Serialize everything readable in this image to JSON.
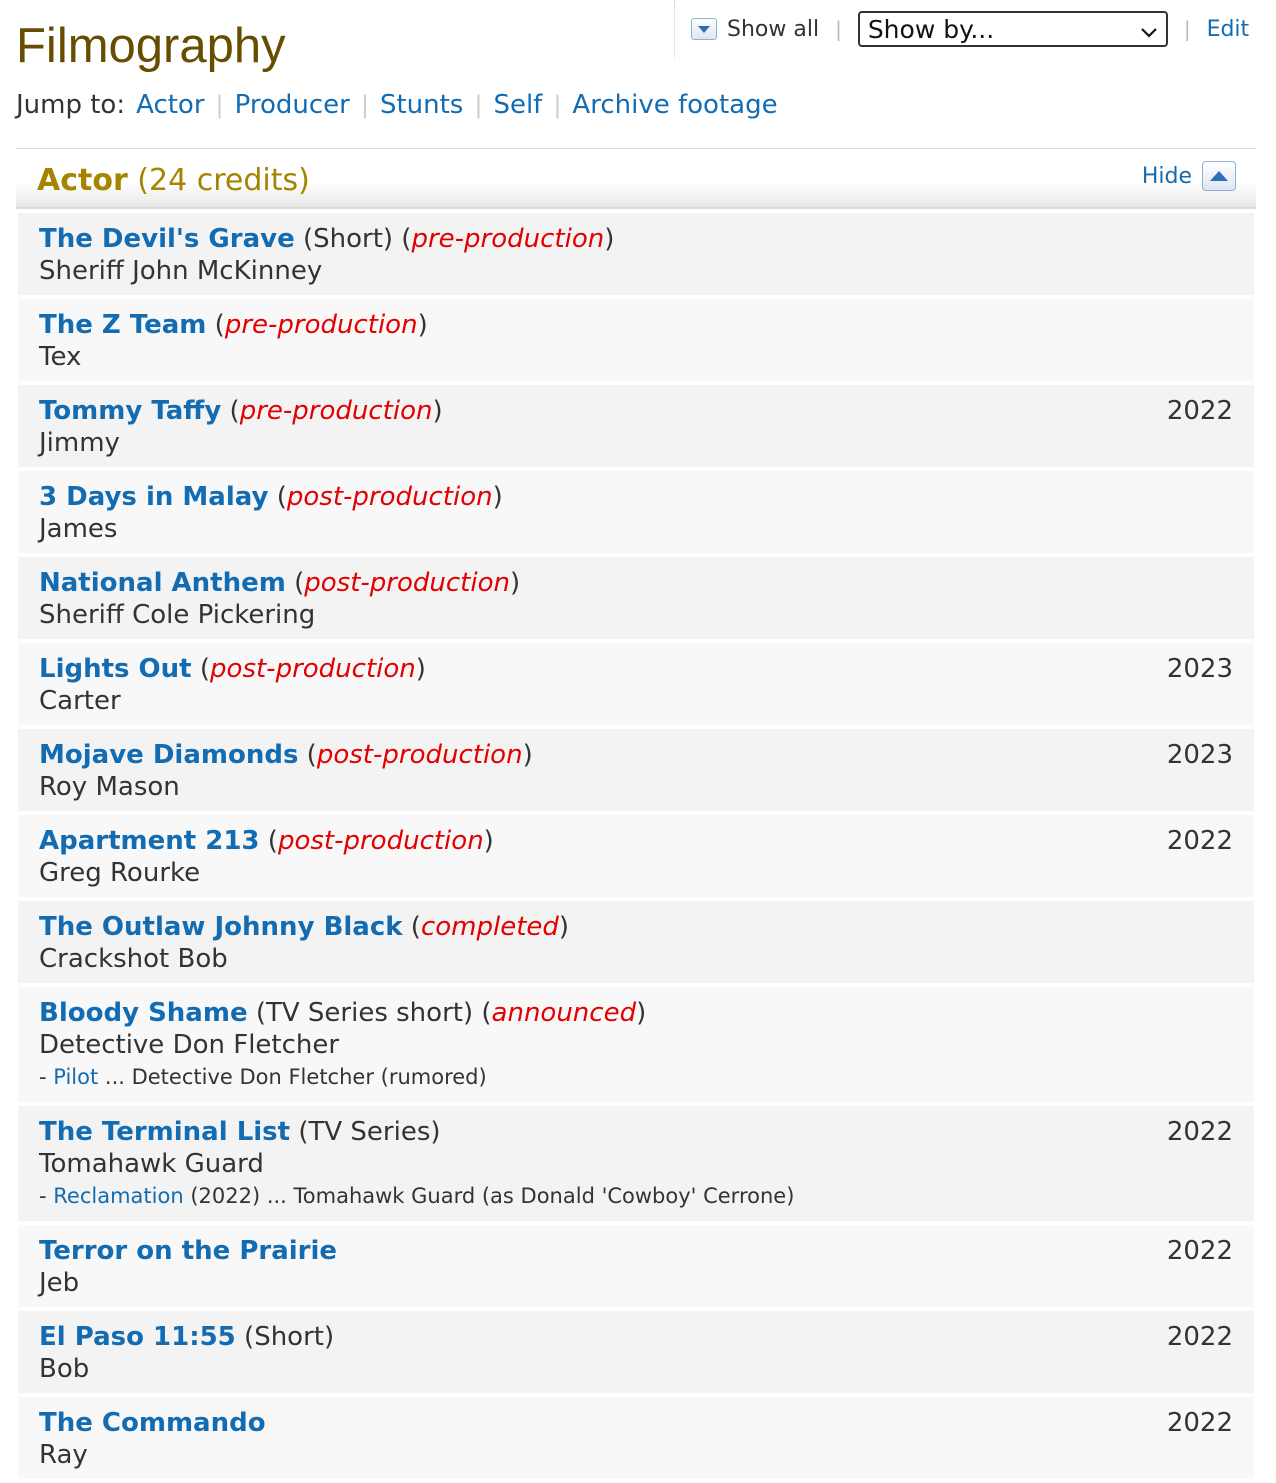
{
  "page": {
    "title": "Filmography",
    "show_all_label": "Show all",
    "show_by_label": "Show by...",
    "edit_label": "Edit",
    "jump_to_label": "Jump to:",
    "jump_links": [
      "Actor",
      "Producer",
      "Stunts",
      "Self",
      "Archive footage"
    ]
  },
  "section": {
    "name": "Actor",
    "credits": "(24 credits)",
    "hide_label": "Hide"
  },
  "colors": {
    "link": "#136cb2",
    "status": "#e20000",
    "section_title": "#a58500",
    "page_title": "#664d00"
  },
  "credits": [
    {
      "title": "The Devil's Grave",
      "type": "(Short)",
      "status": "pre-production",
      "role": "Sheriff John McKinney",
      "year": ""
    },
    {
      "title": "The Z Team",
      "type": "",
      "status": "pre-production",
      "role": "Tex",
      "year": ""
    },
    {
      "title": "Tommy Taffy",
      "type": "",
      "status": "pre-production",
      "role": "Jimmy",
      "year": "2022"
    },
    {
      "title": "3 Days in Malay",
      "type": "",
      "status": "post-production",
      "role": "James",
      "year": ""
    },
    {
      "title": "National Anthem",
      "type": "",
      "status": "post-production",
      "role": "Sheriff Cole Pickering",
      "year": ""
    },
    {
      "title": "Lights Out",
      "type": "",
      "status": "post-production",
      "role": "Carter",
      "year": "2023"
    },
    {
      "title": "Mojave Diamonds",
      "type": "",
      "status": "post-production",
      "role": "Roy Mason",
      "year": "2023"
    },
    {
      "title": "Apartment 213",
      "type": "",
      "status": "post-production",
      "role": "Greg Rourke",
      "year": "2022"
    },
    {
      "title": "The Outlaw Johnny Black",
      "type": "",
      "status": "completed",
      "role": "Crackshot Bob",
      "year": ""
    },
    {
      "title": "Bloody Shame",
      "type": "(TV Series short)",
      "status": "announced",
      "role": "Detective Don Fletcher",
      "year": "",
      "episode": {
        "prefix": "- ",
        "link": "Pilot",
        "text": " ... Detective Don Fletcher (rumored)"
      }
    },
    {
      "title": "The Terminal List",
      "type": "(TV Series)",
      "status": "",
      "role": "Tomahawk Guard",
      "year": "2022",
      "episode": {
        "prefix": "- ",
        "link": "Reclamation",
        "text": " (2022) ... Tomahawk Guard (as Donald 'Cowboy' Cerrone)"
      }
    },
    {
      "title": "Terror on the Prairie",
      "type": "",
      "status": "",
      "role": "Jeb",
      "year": "2022"
    },
    {
      "title": "El Paso 11:55",
      "type": "(Short)",
      "status": "",
      "role": "Bob",
      "year": "2022"
    },
    {
      "title": "The Commando",
      "type": "",
      "status": "",
      "role": "Ray",
      "year": "2022"
    }
  ]
}
